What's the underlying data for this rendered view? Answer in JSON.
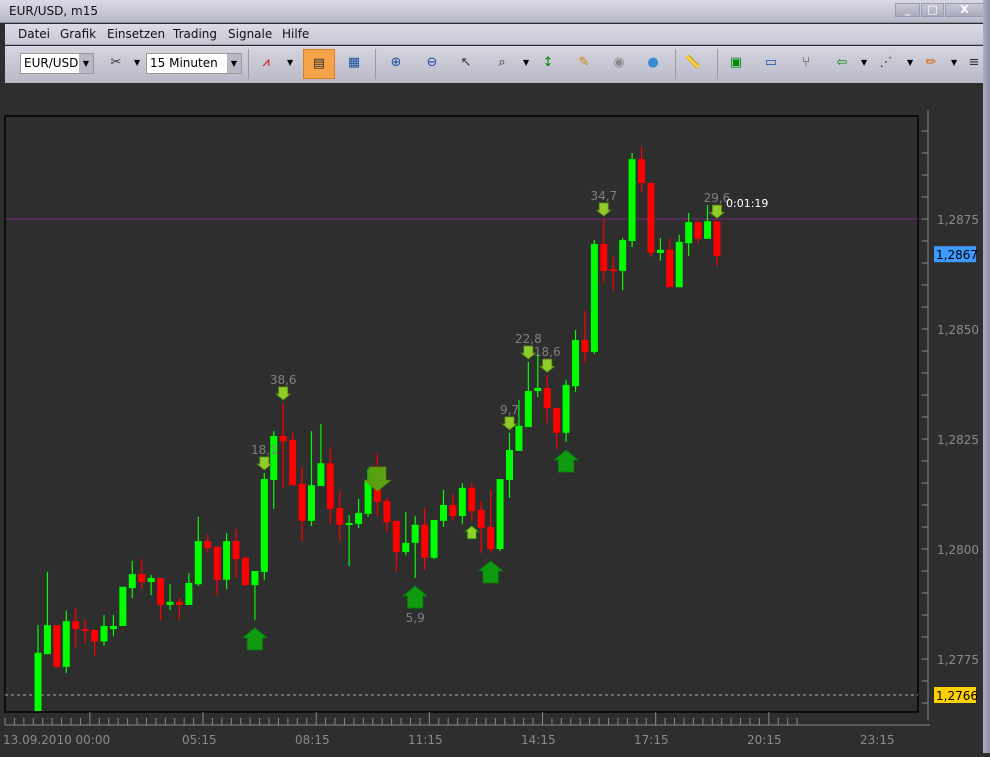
{
  "window": {
    "title": "EUR/USD, m15",
    "minimize": "_",
    "maximize": "□",
    "close": "X"
  },
  "menu": [
    "Datei",
    "Grafik",
    "Einsetzen",
    "Trading",
    "Signale",
    "Hilfe"
  ],
  "toolbar": {
    "symbol": "EUR/USD",
    "timeframe": "15 Minuten"
  },
  "chart_data": {
    "type": "candlestick",
    "symbol": "EUR/USD",
    "timeframe": "m15",
    "ylim": [
      1.27625,
      1.29215
    ],
    "y_ticks": [
      {
        "v": 1.2875,
        "label": "1,2875"
      },
      {
        "v": 1.285,
        "label": "1,2850"
      },
      {
        "v": 1.2825,
        "label": "1,2825"
      },
      {
        "v": 1.28,
        "label": "1,2800"
      },
      {
        "v": 1.2775,
        "label": "1,2775"
      }
    ],
    "x_labels": [
      "13.09.2010 00:00",
      "05:15",
      "08:15",
      "11:15",
      "14:15",
      "17:15",
      "20:15",
      "23:15"
    ],
    "current_price": {
      "value": 1.2867,
      "label": "1,2867",
      "color": "#3d9bff"
    },
    "low_marker": {
      "value": 1.2766,
      "label": "1,2766",
      "color": "#ffd000"
    },
    "ref_line": {
      "value": 1.2875,
      "color": "#c020c0"
    },
    "timer": "0:01:19",
    "candles_ohlc": [
      [
        1.27623,
        1.27827,
        1.2762,
        1.27764
      ],
      [
        1.27761,
        1.27948,
        1.27761,
        1.27827
      ],
      [
        1.27827,
        1.27827,
        1.2773,
        1.27732
      ],
      [
        1.27732,
        1.2786,
        1.27718,
        1.27836
      ],
      [
        1.27836,
        1.27866,
        1.27777,
        1.27818
      ],
      [
        1.27818,
        1.2784,
        1.27786,
        1.27814
      ],
      [
        1.27816,
        1.27816,
        1.27757,
        1.2779
      ],
      [
        1.2779,
        1.2785,
        1.2778,
        1.27825
      ],
      [
        1.27818,
        1.2785,
        1.27802,
        1.27825
      ],
      [
        1.27825,
        1.27914,
        1.27825,
        1.27914
      ],
      [
        1.27911,
        1.27973,
        1.27889,
        1.27943
      ],
      [
        1.27943,
        1.27977,
        1.27909,
        1.27925
      ],
      [
        1.27925,
        1.27941,
        1.27895,
        1.27934
      ],
      [
        1.27934,
        1.27934,
        1.27839,
        1.27873
      ],
      [
        1.27873,
        1.2792,
        1.27861,
        1.2788
      ],
      [
        1.2788,
        1.27889,
        1.27839,
        1.27873
      ],
      [
        1.27873,
        1.27945,
        1.27873,
        1.27923
      ],
      [
        1.2792,
        1.28073,
        1.27916,
        1.28018
      ],
      [
        1.28018,
        1.28034,
        1.27991,
        1.28002
      ],
      [
        1.28005,
        1.28005,
        1.27895,
        1.2793
      ],
      [
        1.2793,
        1.28036,
        1.27909,
        1.28018
      ],
      [
        1.28018,
        1.28045,
        1.27934,
        1.27977
      ],
      [
        1.2798,
        1.27982,
        1.27916,
        1.27918
      ],
      [
        1.27918,
        1.2795,
        1.27839,
        1.2795
      ],
      [
        1.27948,
        1.28173,
        1.2793,
        1.28159
      ],
      [
        1.28157,
        1.28268,
        1.28091,
        1.28257
      ],
      [
        1.28257,
        1.28332,
        1.28139,
        1.28245
      ],
      [
        1.28248,
        1.28264,
        1.28145,
        1.28145
      ],
      [
        1.28148,
        1.28186,
        1.28018,
        1.28064
      ],
      [
        1.28064,
        1.28268,
        1.28052,
        1.28145
      ],
      [
        1.28143,
        1.28284,
        1.28143,
        1.28195
      ],
      [
        1.28195,
        1.2823,
        1.28059,
        1.28091
      ],
      [
        1.28093,
        1.28132,
        1.28018,
        1.28055
      ],
      [
        1.28055,
        1.28077,
        1.27961,
        1.28059
      ],
      [
        1.28057,
        1.28114,
        1.28048,
        1.28082
      ],
      [
        1.2808,
        1.28182,
        1.28073,
        1.28157
      ],
      [
        1.28157,
        1.28218,
        1.28075,
        1.28107
      ],
      [
        1.28109,
        1.28116,
        1.28039,
        1.28061
      ],
      [
        1.28064,
        1.28064,
        1.2795,
        1.27993
      ],
      [
        1.27993,
        1.28084,
        1.27986,
        1.28014
      ],
      [
        1.28014,
        1.28075,
        1.27934,
        1.28055
      ],
      [
        1.28055,
        1.28093,
        1.27952,
        1.2798
      ],
      [
        1.2798,
        1.28066,
        1.27977,
        1.28066
      ],
      [
        1.28064,
        1.28134,
        1.2805,
        1.281
      ],
      [
        1.281,
        1.28125,
        1.28064,
        1.28075
      ],
      [
        1.28075,
        1.2815,
        1.28057,
        1.28139
      ],
      [
        1.28139,
        1.2815,
        1.28064,
        1.28086
      ],
      [
        1.28089,
        1.28109,
        1.27991,
        1.28048
      ],
      [
        1.2805,
        1.28134,
        1.27991,
        1.28
      ],
      [
        1.28,
        1.28159,
        1.27995,
        1.28159
      ],
      [
        1.28157,
        1.28264,
        1.28116,
        1.28225
      ],
      [
        1.28223,
        1.28339,
        1.28223,
        1.2828
      ],
      [
        1.28277,
        1.28425,
        1.28277,
        1.28359
      ],
      [
        1.28359,
        1.28445,
        1.28345,
        1.28366
      ],
      [
        1.28366,
        1.28395,
        1.28286,
        1.2832
      ],
      [
        1.2832,
        1.2832,
        1.28227,
        1.28264
      ],
      [
        1.28264,
        1.28384,
        1.28243,
        1.28373
      ],
      [
        1.2837,
        1.28498,
        1.28357,
        1.28475
      ],
      [
        1.28475,
        1.28541,
        1.28423,
        1.28448
      ],
      [
        1.28448,
        1.28702,
        1.28443,
        1.28693
      ],
      [
        1.28693,
        1.2875,
        1.28605,
        1.28632
      ],
      [
        1.28636,
        1.28664,
        1.28586,
        1.28632
      ],
      [
        1.28632,
        1.28707,
        1.28588,
        1.28702
      ],
      [
        1.287,
        1.289,
        1.28686,
        1.28886
      ],
      [
        1.28886,
        1.28914,
        1.28811,
        1.28832
      ],
      [
        1.28832,
        1.28832,
        1.28664,
        1.28673
      ],
      [
        1.28673,
        1.28707,
        1.28655,
        1.2868
      ],
      [
        1.2868,
        1.28705,
        1.28595,
        1.28595
      ],
      [
        1.28595,
        1.28714,
        1.28595,
        1.28698
      ],
      [
        1.28695,
        1.28764,
        1.28666,
        1.28743
      ],
      [
        1.28743,
        1.28743,
        1.28695,
        1.28705
      ],
      [
        1.28705,
        1.28782,
        1.28705,
        1.28745
      ],
      [
        1.28745,
        1.28745,
        1.28643,
        1.28666
      ]
    ],
    "sell_signals": [
      {
        "candle": 25,
        "label": "18,1"
      },
      {
        "candle": 27,
        "label": "38,6"
      },
      {
        "candle": 51,
        "label": "9,7"
      },
      {
        "candle": 53,
        "label": "22,8"
      },
      {
        "candle": 55,
        "label": "18,6"
      },
      {
        "candle": 61,
        "label": "34,7"
      },
      {
        "candle": 73,
        "label": "29,6"
      }
    ],
    "buy_signals": [
      {
        "candle": 24,
        "size": "big",
        "label": ""
      },
      {
        "candle": 41,
        "size": "big",
        "label": "5,9"
      },
      {
        "candle": 49,
        "size": "big",
        "label": ""
      },
      {
        "candle": 57,
        "size": "big",
        "label": ""
      },
      {
        "candle": 47,
        "size": "small",
        "label": ""
      }
    ],
    "big_sell_signals": [
      {
        "candle": 37
      }
    ],
    "colors": {
      "bull": "#00ff00",
      "bear": "#ff0000",
      "background": "#2e2e2e"
    }
  }
}
